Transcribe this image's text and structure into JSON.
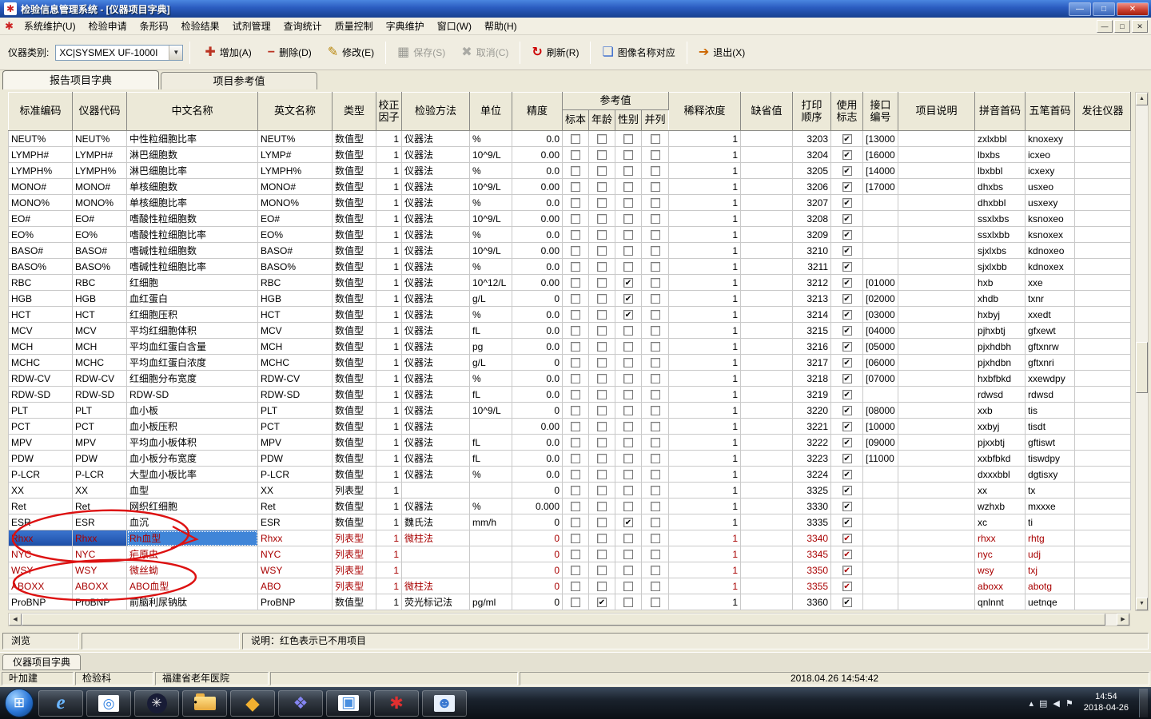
{
  "window": {
    "title": "检验信息管理系统 - [仪器项目字典]"
  },
  "menu": {
    "items": [
      "系统维护(U)",
      "检验申请",
      "条形码",
      "检验结果",
      "试剂管理",
      "查询统计",
      "质量控制",
      "字典维护",
      "窗口(W)",
      "帮助(H)"
    ]
  },
  "toolbar": {
    "device_type_label": "仪器类别:",
    "device_type_value": "XC|SYSMEX UF-1000I",
    "buttons": [
      {
        "name": "add",
        "label": "增加(A)",
        "icon": "add",
        "enabled": true,
        "sep": false
      },
      {
        "name": "delete",
        "label": "删除(D)",
        "icon": "del",
        "enabled": true,
        "sep": false
      },
      {
        "name": "modify",
        "label": "修改(E)",
        "icon": "edit",
        "enabled": true,
        "sep": true
      },
      {
        "name": "save",
        "label": "保存(S)",
        "icon": "save",
        "enabled": false,
        "sep": false
      },
      {
        "name": "cancel",
        "label": "取消(C)",
        "icon": "cancel",
        "enabled": false,
        "sep": true
      },
      {
        "name": "refresh",
        "label": "刷新(R)",
        "icon": "refresh",
        "enabled": true,
        "sep": true
      },
      {
        "name": "image-map",
        "label": "图像名称对应",
        "icon": "image",
        "enabled": true,
        "sep": true
      },
      {
        "name": "exit",
        "label": "退出(X)",
        "icon": "exit",
        "enabled": true,
        "sep": false
      }
    ]
  },
  "tabs": [
    "报告项目字典",
    "项目参考值"
  ],
  "table": {
    "headers": [
      "标准编码",
      "仪器代码",
      "中文名称",
      "英文名称",
      "类型",
      "校正\n因子",
      "检验方法",
      "单位",
      "精度",
      "稀释浓度",
      "缺省值",
      "打印\n顺序",
      "使用\n标志",
      "接口\n编号",
      "项目说明",
      "拼音首码",
      "五笔首码",
      "发往仪器"
    ],
    "ref_group": {
      "label": "参考值",
      "subs": [
        "标本",
        "年龄",
        "性别",
        "并列"
      ]
    },
    "red_rows": [
      25,
      26,
      27,
      28
    ],
    "selection": {
      "row": 25,
      "cells": [
        0,
        1
      ],
      "focus": 2
    },
    "rows": [
      [
        "NEUT%",
        "NEUT%",
        "中性粒细胞比率",
        "NEUT%",
        "数值型",
        "1",
        "仪器法",
        "%",
        "0.0",
        0,
        0,
        0,
        0,
        "1",
        "",
        "3203",
        1,
        "[13000",
        "",
        "zxlxbbl",
        "knoxexy",
        ""
      ],
      [
        "LYMPH#",
        "LYMPH#",
        "淋巴细胞数",
        "LYMP#",
        "数值型",
        "1",
        "仪器法",
        "10^9/L",
        "0.00",
        0,
        0,
        0,
        0,
        "1",
        "",
        "3204",
        1,
        "[16000",
        "",
        "lbxbs",
        "icxeo",
        ""
      ],
      [
        "LYMPH%",
        "LYMPH%",
        "淋巴细胞比率",
        "LYMPH%",
        "数值型",
        "1",
        "仪器法",
        "%",
        "0.0",
        0,
        0,
        0,
        0,
        "1",
        "",
        "3205",
        1,
        "[14000",
        "",
        "lbxbbl",
        "icxexy",
        ""
      ],
      [
        "MONO#",
        "MONO#",
        "单核细胞数",
        "MONO#",
        "数值型",
        "1",
        "仪器法",
        "10^9/L",
        "0.00",
        0,
        0,
        0,
        0,
        "1",
        "",
        "3206",
        1,
        "[17000",
        "",
        "dhxbs",
        "usxeo",
        ""
      ],
      [
        "MONO%",
        "MONO%",
        "单核细胞比率",
        "MONO%",
        "数值型",
        "1",
        "仪器法",
        "%",
        "0.0",
        0,
        0,
        0,
        0,
        "1",
        "",
        "3207",
        1,
        "",
        "",
        "dhxbbl",
        "usxexy",
        ""
      ],
      [
        "EO#",
        "EO#",
        "嗜酸性粒细胞数",
        "EO#",
        "数值型",
        "1",
        "仪器法",
        "10^9/L",
        "0.00",
        0,
        0,
        0,
        0,
        "1",
        "",
        "3208",
        1,
        "",
        "",
        "ssxlxbs",
        "ksnoxeo",
        ""
      ],
      [
        "EO%",
        "EO%",
        "嗜酸性粒细胞比率",
        "EO%",
        "数值型",
        "1",
        "仪器法",
        "%",
        "0.0",
        0,
        0,
        0,
        0,
        "1",
        "",
        "3209",
        1,
        "",
        "",
        "ssxlxbb",
        "ksnoxex",
        ""
      ],
      [
        "BASO#",
        "BASO#",
        "嗜碱性粒细胞数",
        "BASO#",
        "数值型",
        "1",
        "仪器法",
        "10^9/L",
        "0.00",
        0,
        0,
        0,
        0,
        "1",
        "",
        "3210",
        1,
        "",
        "",
        "sjxlxbs",
        "kdnoxeo",
        ""
      ],
      [
        "BASO%",
        "BASO%",
        "嗜碱性粒细胞比率",
        "BASO%",
        "数值型",
        "1",
        "仪器法",
        "%",
        "0.0",
        0,
        0,
        0,
        0,
        "1",
        "",
        "3211",
        1,
        "",
        "",
        "sjxlxbb",
        "kdnoxex",
        ""
      ],
      [
        "RBC",
        "RBC",
        "红细胞",
        "RBC",
        "数值型",
        "1",
        "仪器法",
        "10^12/L",
        "0.00",
        0,
        0,
        1,
        0,
        "1",
        "",
        "3212",
        1,
        "[01000",
        "",
        "hxb",
        "xxe",
        ""
      ],
      [
        "HGB",
        "HGB",
        "血红蛋白",
        "HGB",
        "数值型",
        "1",
        "仪器法",
        "g/L",
        "0",
        0,
        0,
        1,
        0,
        "1",
        "",
        "3213",
        1,
        "[02000",
        "",
        "xhdb",
        "txnr",
        ""
      ],
      [
        "HCT",
        "HCT",
        "红细胞压积",
        "HCT",
        "数值型",
        "1",
        "仪器法",
        "%",
        "0.0",
        0,
        0,
        1,
        0,
        "1",
        "",
        "3214",
        1,
        "[03000",
        "",
        "hxbyj",
        "xxedt",
        ""
      ],
      [
        "MCV",
        "MCV",
        "平均红细胞体积",
        "MCV",
        "数值型",
        "1",
        "仪器法",
        "fL",
        "0.0",
        0,
        0,
        0,
        0,
        "1",
        "",
        "3215",
        1,
        "[04000",
        "",
        "pjhxbtj",
        "gfxewt",
        ""
      ],
      [
        "MCH",
        "MCH",
        "平均血红蛋白含量",
        "MCH",
        "数值型",
        "1",
        "仪器法",
        "pg",
        "0.0",
        0,
        0,
        0,
        0,
        "1",
        "",
        "3216",
        1,
        "[05000",
        "",
        "pjxhdbh",
        "gftxnrw",
        ""
      ],
      [
        "MCHC",
        "MCHC",
        "平均血红蛋白浓度",
        "MCHC",
        "数值型",
        "1",
        "仪器法",
        "g/L",
        "0",
        0,
        0,
        0,
        0,
        "1",
        "",
        "3217",
        1,
        "[06000",
        "",
        "pjxhdbn",
        "gftxnri",
        ""
      ],
      [
        "RDW-CV",
        "RDW-CV",
        "红细胞分布宽度",
        "RDW-CV",
        "数值型",
        "1",
        "仪器法",
        "%",
        "0.0",
        0,
        0,
        0,
        0,
        "1",
        "",
        "3218",
        1,
        "[07000",
        "",
        "hxbfbkd",
        "xxewdpy",
        ""
      ],
      [
        "RDW-SD",
        "RDW-SD",
        "RDW-SD",
        "RDW-SD",
        "数值型",
        "1",
        "仪器法",
        "fL",
        "0.0",
        0,
        0,
        0,
        0,
        "1",
        "",
        "3219",
        1,
        "",
        "",
        "rdwsd",
        "rdwsd",
        ""
      ],
      [
        "PLT",
        "PLT",
        "血小板",
        "PLT",
        "数值型",
        "1",
        "仪器法",
        "10^9/L",
        "0",
        0,
        0,
        0,
        0,
        "1",
        "",
        "3220",
        1,
        "[08000",
        "",
        "xxb",
        "tis",
        ""
      ],
      [
        "PCT",
        "PCT",
        "血小板压积",
        "PCT",
        "数值型",
        "1",
        "仪器法",
        "",
        "0.00",
        0,
        0,
        0,
        0,
        "1",
        "",
        "3221",
        1,
        "[10000",
        "",
        "xxbyj",
        "tisdt",
        ""
      ],
      [
        "MPV",
        "MPV",
        "平均血小板体积",
        "MPV",
        "数值型",
        "1",
        "仪器法",
        "fL",
        "0.0",
        0,
        0,
        0,
        0,
        "1",
        "",
        "3222",
        1,
        "[09000",
        "",
        "pjxxbtj",
        "gftiswt",
        ""
      ],
      [
        "PDW",
        "PDW",
        "血小板分布宽度",
        "PDW",
        "数值型",
        "1",
        "仪器法",
        "fL",
        "0.0",
        0,
        0,
        0,
        0,
        "1",
        "",
        "3223",
        1,
        "[11000",
        "",
        "xxbfbkd",
        "tiswdpy",
        ""
      ],
      [
        "P-LCR",
        "P-LCR",
        "大型血小板比率",
        "P-LCR",
        "数值型",
        "1",
        "仪器法",
        "%",
        "0.0",
        0,
        0,
        0,
        0,
        "1",
        "",
        "3224",
        1,
        "",
        "",
        "dxxxbbl",
        "dgtisxy",
        ""
      ],
      [
        "XX",
        "XX",
        "血型",
        "XX",
        "列表型",
        "1",
        "",
        "",
        "0",
        0,
        0,
        0,
        0,
        "1",
        "",
        "3325",
        1,
        "",
        "",
        "xx",
        "tx",
        ""
      ],
      [
        "Ret",
        "Ret",
        "网织红细胞",
        "Ret",
        "数值型",
        "1",
        "仪器法",
        "%",
        "0.000",
        0,
        0,
        0,
        0,
        "1",
        "",
        "3330",
        1,
        "",
        "",
        "wzhxb",
        "mxxxe",
        ""
      ],
      [
        "ESR",
        "ESR",
        "血沉",
        "ESR",
        "数值型",
        "1",
        "魏氏法",
        "mm/h",
        "0",
        0,
        0,
        1,
        0,
        "1",
        "",
        "3335",
        1,
        "",
        "",
        "xc",
        "ti",
        ""
      ],
      [
        "Rhxx",
        "Rhxx",
        "Rh血型",
        "Rhxx",
        "列表型",
        "1",
        "微柱法",
        "",
        "0",
        0,
        0,
        0,
        0,
        "1",
        "",
        "3340",
        1,
        "",
        "",
        "rhxx",
        "rhtg",
        ""
      ],
      [
        "NYC",
        "NYC",
        "疟原虫",
        "NYC",
        "列表型",
        "1",
        "",
        "",
        "0",
        0,
        0,
        0,
        0,
        "1",
        "",
        "3345",
        1,
        "",
        "",
        "nyc",
        "udj",
        ""
      ],
      [
        "WSY",
        "WSY",
        "微丝蚴",
        "WSY",
        "列表型",
        "1",
        "",
        "",
        "0",
        0,
        0,
        0,
        0,
        "1",
        "",
        "3350",
        1,
        "",
        "",
        "wsy",
        "txj",
        ""
      ],
      [
        "ABOXX",
        "ABOXX",
        "ABO血型",
        "ABO",
        "列表型",
        "1",
        "微柱法",
        "",
        "0",
        0,
        0,
        0,
        0,
        "1",
        "",
        "3355",
        1,
        "",
        "",
        "aboxx",
        "abotg",
        ""
      ],
      [
        "ProBNP",
        "ProBNP",
        "前脑利尿钠肽",
        "ProBNP",
        "数值型",
        "1",
        "荧光标记法",
        "pg/ml",
        "0",
        0,
        1,
        0,
        0,
        "1",
        "",
        "3360",
        1,
        "",
        "",
        "qnlnnt",
        "uetnqe",
        ""
      ]
    ]
  },
  "bottom": {
    "browse_label": "浏览",
    "note": "说明：红色表示已不用项目"
  },
  "statusbar": {
    "window_tab": "仪器项目字典",
    "user": "叶加建",
    "dept": "检验科",
    "hospital": "福建省老年医院",
    "datetime": "2018.04.26 14:54:42"
  },
  "taskbar": {
    "icons": [
      "ie",
      "search-tool",
      "compass",
      "folder",
      "diamond-yellow",
      "diamond-blue",
      "app-window",
      "lis-app",
      "user"
    ],
    "tray_icons": [
      "chevron-up",
      "input-indicator",
      "volume",
      "flag"
    ],
    "time": "14:54",
    "date": "2018-04-26"
  }
}
